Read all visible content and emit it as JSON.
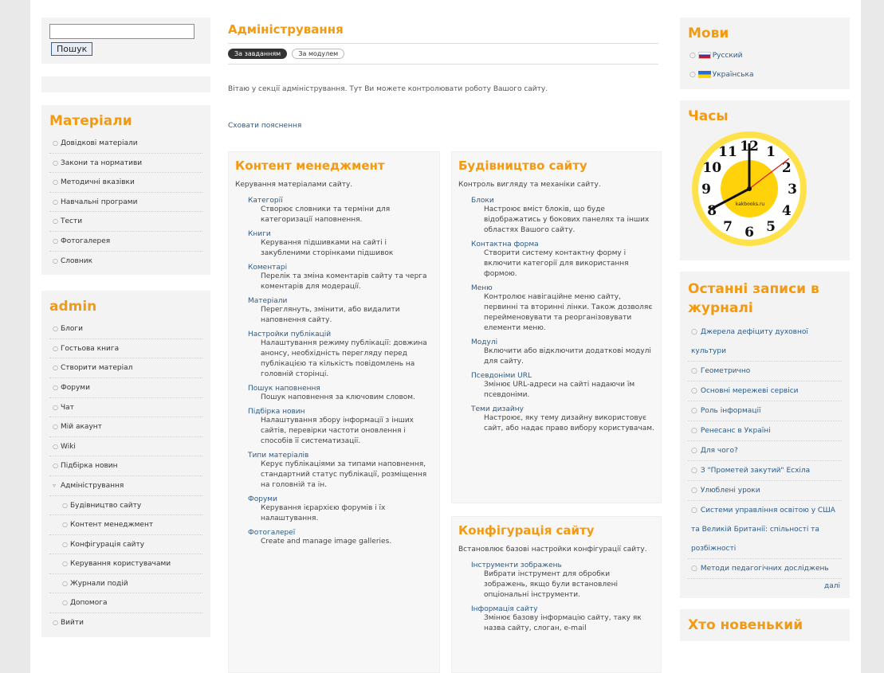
{
  "search": {
    "button": "Пошук"
  },
  "materials": {
    "title": "Матеріали",
    "items": [
      "Довідкові матеріали",
      "Закони та нормативи",
      "Методичні вказівки",
      "Навчальні програми",
      "Тести",
      "Фотогалерея",
      "Словник"
    ]
  },
  "admin": {
    "title": "admin",
    "items": [
      {
        "label": "Блоги",
        "sub": false
      },
      {
        "label": "Гостьова книга",
        "sub": false
      },
      {
        "label": "Створити матеріал",
        "sub": false
      },
      {
        "label": "Форуми",
        "sub": false
      },
      {
        "label": "Чат",
        "sub": false
      },
      {
        "label": "Мій акаунт",
        "sub": false
      },
      {
        "label": "Wiki",
        "sub": false
      },
      {
        "label": "Підбірка новин",
        "sub": false
      },
      {
        "label": "Адміністрування",
        "sub": false
      },
      {
        "label": "Будівництво сайту",
        "sub": true
      },
      {
        "label": "Контент менеджмент",
        "sub": true
      },
      {
        "label": "Конфігурація сайту",
        "sub": true
      },
      {
        "label": "Керування користувачами",
        "sub": true
      },
      {
        "label": "Журнали подій",
        "sub": true
      },
      {
        "label": "Допомога",
        "sub": true
      },
      {
        "label": "Вийти",
        "sub": false
      }
    ]
  },
  "center": {
    "title": "Адміністрування",
    "tabs": [
      "За завданням",
      "За модулем"
    ],
    "intro": "Вітаю у секції адміністрування. Тут Ви можете контролювати роботу Вашого сайту.",
    "hide_link": "Сховати пояснення",
    "content": {
      "title": "Контент менеджмент",
      "desc": "Керування матеріалами сайту.",
      "items": [
        {
          "link": "Категорії",
          "desc": "Створює словники та терміни для категоризації наповнення."
        },
        {
          "link": "Книги",
          "desc": "Керування підшивками на сайті і закубленими сторінками підшивок"
        },
        {
          "link": "Коментарі",
          "desc": "Перелік та зміна коментарів сайту та черга коментарів для модерації."
        },
        {
          "link": "Матеріали",
          "desc": "Переглянуть, змінити, або видалити наповнення сайту."
        },
        {
          "link": "Настройки публікацій",
          "desc": "Налаштування режиму публікації: довжина анонсу, необхідність перегляду перед публікацією та кількість повідомлень на головній сторінці."
        },
        {
          "link": "Пошук наповнення",
          "desc": "Пошук наповнення за ключовим словом."
        },
        {
          "link": "Підбірка новин",
          "desc": "Налаштування збору інформації з інших сайтів, перевірки частоти оновлення і способів її систематизації."
        },
        {
          "link": "Типи матеріалів",
          "desc": "Керує публікаціями за типами наповнення, стандартний статус публікації, розміщення на головній та ін."
        },
        {
          "link": "Форуми",
          "desc": "Керування ієрархією форумів і їх налаштування."
        },
        {
          "link": "Фотогалереї",
          "desc": "Create and manage image galleries."
        }
      ]
    },
    "build": {
      "title": "Будівництво сайту",
      "desc": "Контроль вигляду та механіки сайту.",
      "items": [
        {
          "link": "Блоки",
          "desc": "Настроює вміст блоків, що буде відображатись у бокових панелях та інших областях Вашого сайту."
        },
        {
          "link": "Контактна форма",
          "desc": "Створити систему контактну форму і включити категорії для використання формою."
        },
        {
          "link": "Меню",
          "desc": "Контролює навігаційне меню сайту, первинні та вторинні лінки. Також дозволяє перейменовувати та реорганізовувати елементи меню."
        },
        {
          "link": "Модулі",
          "desc": "Включити або відключити додаткові модулі для сайту."
        },
        {
          "link": "Псевдоніми URL",
          "desc": "Змінює URL-адреси на сайті надаючи їм псевдоніми."
        },
        {
          "link": "Теми дизайну",
          "desc": "Настроює, яку тему дизайну використовує сайт, або надає право вибору користувачам."
        }
      ]
    },
    "config": {
      "title": "Конфігурація сайту",
      "desc": "Встановлює базові настройки конфігурації сайту.",
      "items": [
        {
          "link": "Інструменти зображень",
          "desc": "Вибрати інструмент для обробки зображень, якщо були встановлені опціональні інструменти."
        },
        {
          "link": "Інформація сайту",
          "desc": "Змінює базову інформацію сайту, таку як назва сайту, слоган, e-mail"
        }
      ]
    }
  },
  "languages": {
    "title": "Мови",
    "items": [
      {
        "label": "Русский",
        "flag": "ru"
      },
      {
        "label": "Українська",
        "flag": "ua"
      }
    ]
  },
  "clock": {
    "title": "Часы",
    "numbers": [
      "12",
      "1",
      "2",
      "3",
      "4",
      "5",
      "6",
      "7",
      "8",
      "9",
      "10",
      "11"
    ],
    "brand": "kakbooks.ru"
  },
  "journal": {
    "title": "Останні записи в журналі",
    "items": [
      "Джерела дефіциту духовної культури",
      "Геометрично",
      "Основні мережеві сервіси",
      "Роль інформації",
      "Ренесанс в Україні",
      "Для чого?",
      "З \"Прометей закутий\" Есхіла",
      "Улюблені уроки",
      "Системи управління освітою у США та Великій Британії: спільності та розбіжності",
      "Методи педагогічних досліджень"
    ],
    "more": "далі"
  },
  "whos_new": {
    "title": "Хто новенький"
  }
}
